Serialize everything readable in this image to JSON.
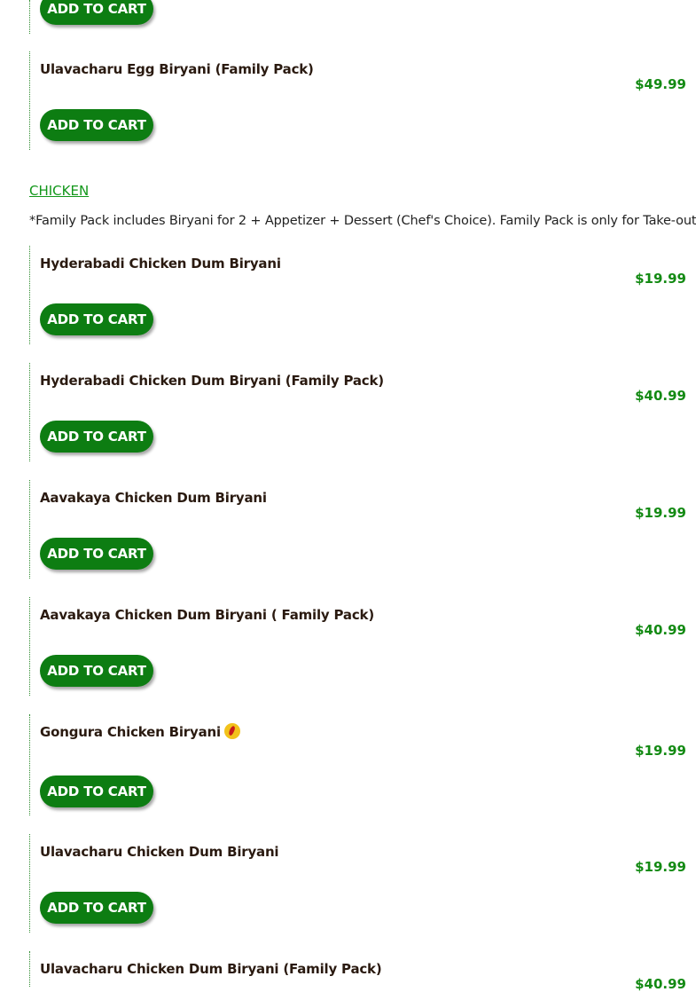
{
  "top_item": {
    "button_label": "ADD TO CART"
  },
  "egg_family": {
    "name": "Ulavacharu Egg Biryani (Family Pack)",
    "price": "$49.99",
    "button_label": "ADD TO CART"
  },
  "section": {
    "title": "CHICKEN",
    "note": "*Family Pack includes Biryani for 2 + Appetizer + Dessert (Chef's Choice). Family Pack is only for Take-out"
  },
  "items": [
    {
      "name": "Hyderabadi Chicken Dum Biryani",
      "price": "$19.99",
      "button_label": "ADD TO CART"
    },
    {
      "name": "Hyderabadi Chicken Dum Biryani (Family Pack)",
      "price": "$40.99",
      "button_label": "ADD TO CART"
    },
    {
      "name": "Aavakaya Chicken Dum Biryani",
      "price": "$19.99",
      "button_label": "ADD TO CART"
    },
    {
      "name": "Aavakaya Chicken Dum Biryani ( Family Pack)",
      "price": "$40.99",
      "button_label": "ADD TO CART"
    },
    {
      "name": "Gongura Chicken Biryani",
      "price": "$19.99",
      "button_label": "ADD TO CART",
      "icon": "spicy-chili-icon"
    },
    {
      "name": "Ulavacharu Chicken Dum Biryani",
      "price": "$19.99",
      "button_label": "ADD TO CART"
    },
    {
      "name": "Ulavacharu Chicken Dum Biryani (Family Pack)",
      "price": "$40.99"
    }
  ],
  "colors": {
    "button": "#0d7d12",
    "price": "#138a13",
    "link": "#12971a"
  }
}
